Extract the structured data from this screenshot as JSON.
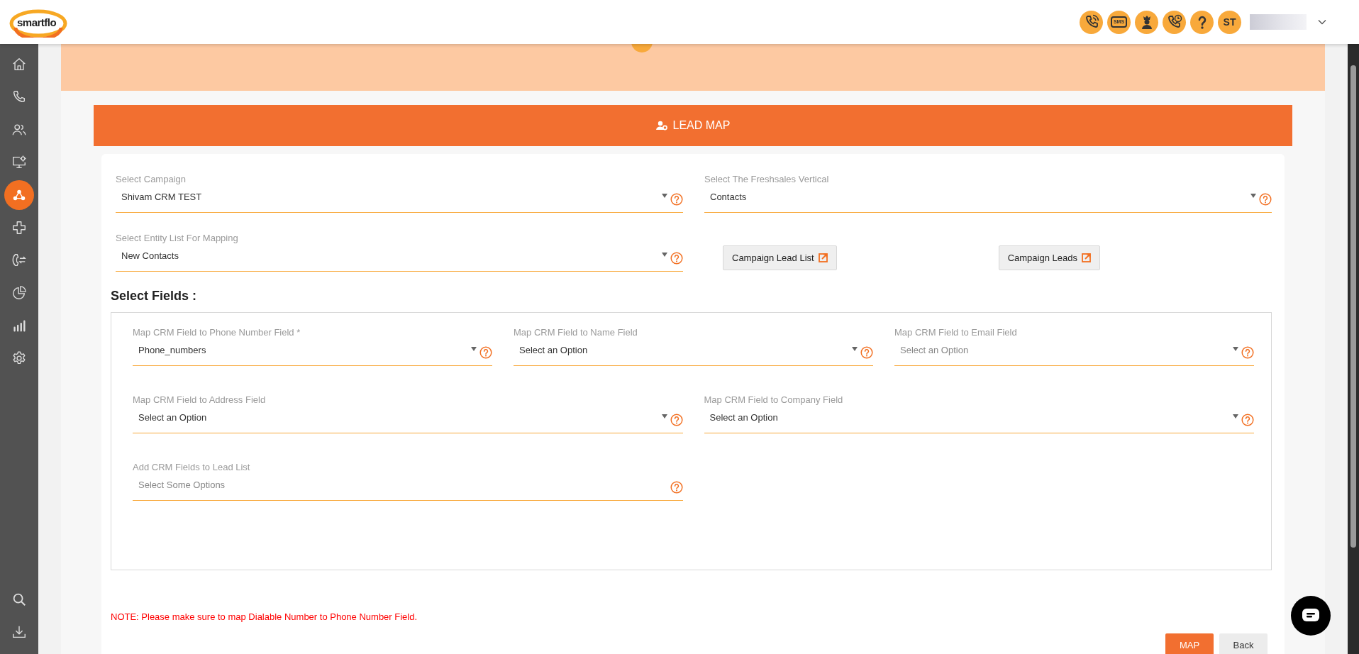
{
  "header": {
    "logo": "smartflo",
    "icons": [
      {
        "kind": "phone"
      },
      {
        "kind": "sms",
        "label": "SMS"
      },
      {
        "kind": "agent"
      },
      {
        "kind": "phone-clock"
      },
      {
        "kind": "help"
      }
    ],
    "user_initials": "ST"
  },
  "sidebar": {
    "items": [
      {
        "kind": "home",
        "selected": false
      },
      {
        "kind": "phone",
        "selected": false
      },
      {
        "kind": "users",
        "selected": false
      },
      {
        "kind": "monitor",
        "selected": false
      },
      {
        "kind": "hub",
        "selected": true
      },
      {
        "kind": "puzzle",
        "selected": false
      },
      {
        "kind": "transfer",
        "selected": false
      },
      {
        "kind": "pie",
        "selected": false
      },
      {
        "kind": "bars",
        "selected": false
      },
      {
        "kind": "gear",
        "selected": false
      }
    ],
    "bottom_items": [
      {
        "kind": "search",
        "selected": false
      },
      {
        "kind": "download",
        "selected": false
      }
    ]
  },
  "panel_title": "LEAD MAP",
  "top_fields": [
    {
      "label": "Select Campaign",
      "value": "Shivam CRM TEST"
    },
    {
      "label": "Select The Freshsales Vertical",
      "value": "Contacts"
    },
    {
      "label": "Select Entity List For Mapping",
      "value": "New Contacts"
    }
  ],
  "link_buttons": [
    "Campaign Lead List",
    "Campaign Leads"
  ],
  "fields_title": "Select Fields :",
  "mapping_rows": [
    [
      {
        "label": "Map CRM Field to Phone Number Field *",
        "value": "Phone_numbers"
      },
      {
        "label": "Map CRM Field to Name Field",
        "value": "Select an Option"
      },
      {
        "label": "Map CRM Field to Email Field",
        "placeholder": "Select an Option"
      }
    ],
    [
      {
        "label": "Map CRM Field to Address Field",
        "value": "Select an Option"
      },
      {
        "label": "Map CRM Field to Company Field",
        "value": "Select an Option"
      }
    ],
    [
      {
        "label": "Add CRM Fields to Lead List",
        "placeholder": "Select Some Options",
        "multi": true
      }
    ]
  ],
  "note": "NOTE: Please make sure to map Dialable Number to Phone Number Field.",
  "actions": [
    {
      "label": "MAP",
      "kind": "primary"
    },
    {
      "label": "Back",
      "kind": "secondary"
    }
  ]
}
